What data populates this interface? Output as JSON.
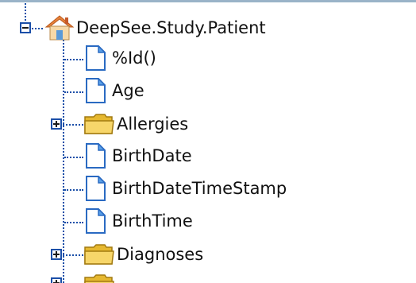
{
  "tree": {
    "root": {
      "label": "DeepSee.Study.Patient",
      "icon": "house-icon",
      "expanded": true
    },
    "items": [
      {
        "label": "%Id()",
        "icon": "document-icon",
        "type": "property"
      },
      {
        "label": "Age",
        "icon": "document-icon",
        "type": "property"
      },
      {
        "label": "Allergies",
        "icon": "folder-icon",
        "type": "folder",
        "expanded": false
      },
      {
        "label": "BirthDate",
        "icon": "document-icon",
        "type": "property"
      },
      {
        "label": "BirthDateTimeStamp",
        "icon": "document-icon",
        "type": "property"
      },
      {
        "label": "BirthTime",
        "icon": "document-icon",
        "type": "property"
      },
      {
        "label": "Diagnoses",
        "icon": "folder-icon",
        "type": "folder",
        "expanded": false
      }
    ]
  },
  "colors": {
    "connector": "#1b4fa8",
    "folder": "#f2c94c",
    "document_fold": "#3a7fd5",
    "house_roof": "#e8823a"
  }
}
